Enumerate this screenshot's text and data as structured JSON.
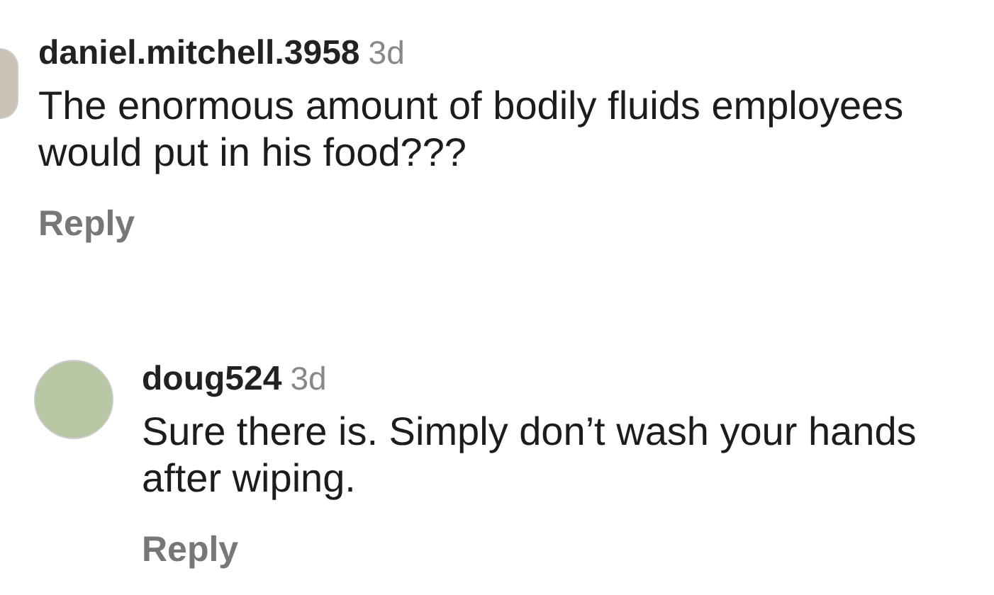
{
  "comments": [
    {
      "username": "daniel.mitchell.3958",
      "time": "3d",
      "text": "The enormous amount of bodily fluids employees would put in his food???",
      "reply": "Reply",
      "kind": "top"
    },
    {
      "username": "doug524",
      "time": "3d",
      "text": "Sure there is. Simply don’t wash your hands after wiping.",
      "reply": "Reply",
      "kind": "reply"
    }
  ]
}
